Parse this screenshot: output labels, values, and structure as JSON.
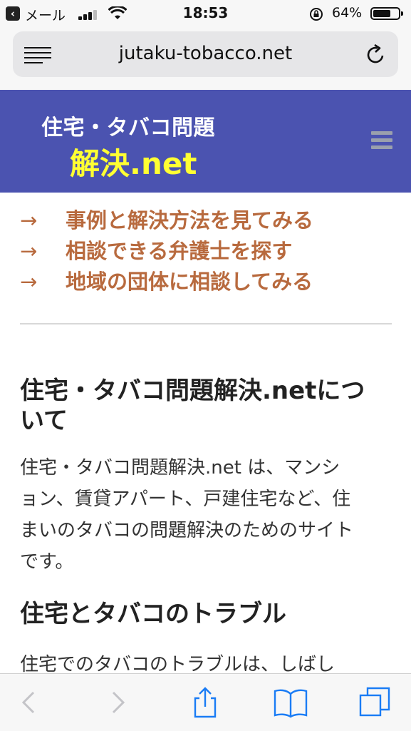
{
  "status_bar": {
    "back_app": "メール",
    "time": "18:53",
    "battery_pct": "64%"
  },
  "browser": {
    "url": "jutaku-tobacco.net"
  },
  "site": {
    "title_line1": "住宅・タバコ問題",
    "title_line2": "解決.net"
  },
  "links": [
    {
      "arrow": "→",
      "label": "事例と解決方法を見てみる"
    },
    {
      "arrow": "→",
      "label": "相談できる弁護士を探す"
    },
    {
      "arrow": "→",
      "label": "地域の団体に相談してみる"
    }
  ],
  "article": {
    "heading1_line1": "住宅・タバコ問題解決.netにつ",
    "heading1_line2": "いて",
    "para1_line1": "住宅・タバコ問題解決.net は、マンシ",
    "para1_line2": "ョン、賃貸アパート、戸建住宅など、住",
    "para1_line3": "まいのタバコの問題解決のためのサイト",
    "para1_line4": "です。",
    "heading2": "住宅とタバコのトラブル",
    "para2_line1": "住宅でのタバコのトラブルは、しばし"
  },
  "colors": {
    "header_bg": "#4b53b0",
    "title_white": "#ffffff",
    "title_yellow": "#ffff33",
    "link": "#b86a3e",
    "ios_blue": "#1a7cf5"
  },
  "icons": {
    "reader": "reader-icon",
    "reload": "reload-icon",
    "menu": "hamburger-icon",
    "back": "chevron-left-icon",
    "forward": "chevron-right-icon",
    "share": "share-icon",
    "bookmarks": "book-icon",
    "tabs": "tabs-icon"
  }
}
